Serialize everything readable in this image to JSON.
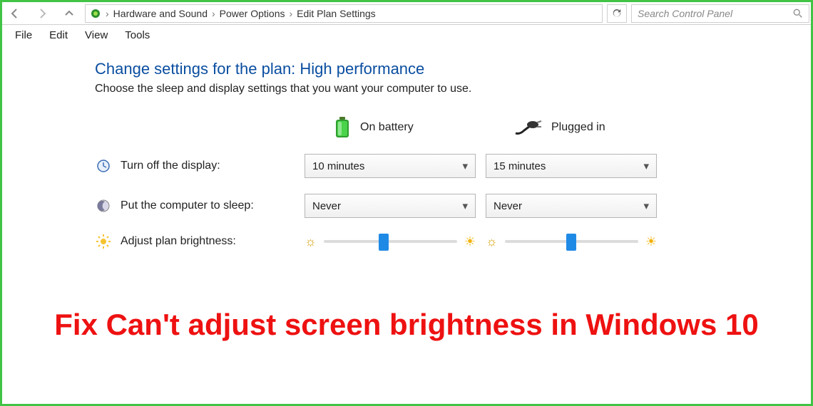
{
  "breadcrumb": {
    "item1": "Hardware and Sound",
    "item2": "Power Options",
    "item3": "Edit Plan Settings"
  },
  "search": {
    "placeholder": "Search Control Panel"
  },
  "menus": {
    "file": "File",
    "edit": "Edit",
    "view": "View",
    "tools": "Tools"
  },
  "title": "Change settings for the plan: High performance",
  "subtitle": "Choose the sleep and display settings that you want your computer to use.",
  "columns": {
    "battery": "On battery",
    "plugged": "Plugged in"
  },
  "rows": {
    "display": "Turn off the display:",
    "sleep": "Put the computer to sleep:",
    "brightness": "Adjust plan brightness:"
  },
  "values": {
    "display_battery": "10 minutes",
    "display_plugged": "15 minutes",
    "sleep_battery": "Never",
    "sleep_plugged": "Never"
  },
  "caption": "Fix Can't adjust screen brightness in Windows 10"
}
